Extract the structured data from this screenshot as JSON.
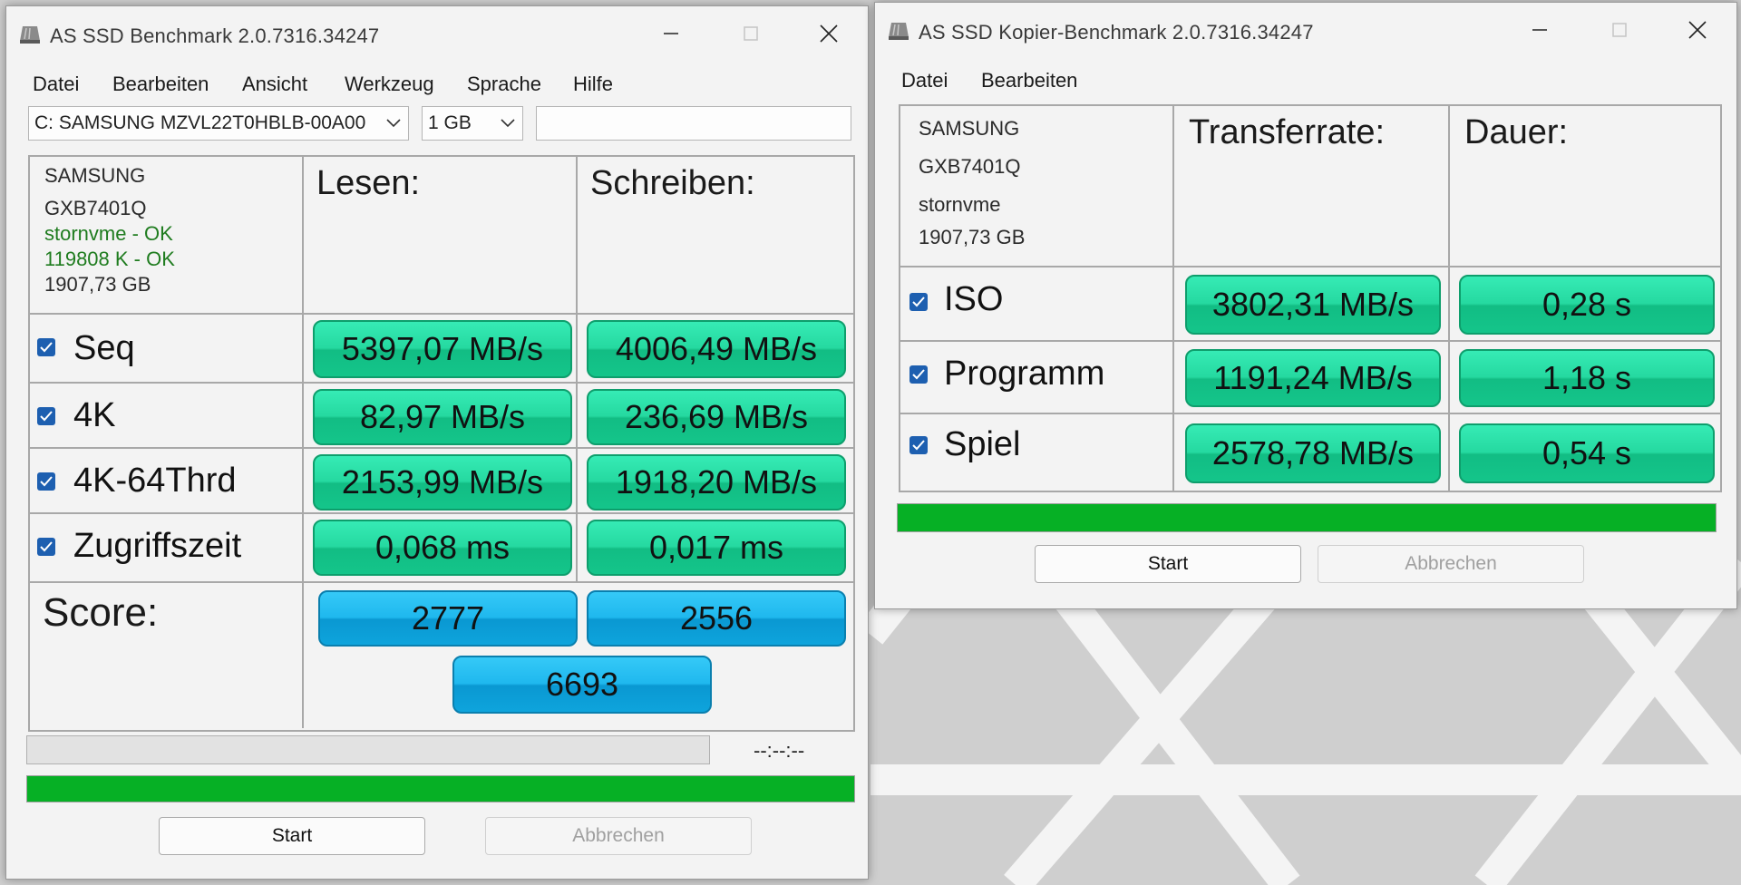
{
  "colors": {
    "value_green": "#25d9a0",
    "score_blue": "#1fb8ee",
    "progress_green": "#06b025",
    "ok_green": "#1f7c1f"
  },
  "main": {
    "title": "AS SSD Benchmark 2.0.7316.34247",
    "menu": [
      "Datei",
      "Bearbeiten",
      "Ansicht",
      "Werkzeug",
      "Sprache",
      "Hilfe"
    ],
    "drive_select": "C: SAMSUNG MZVL22T0HBLB-00A00",
    "size_select": "1 GB",
    "text_field": "",
    "info": {
      "vendor": "SAMSUNG",
      "firmware": "GXB7401Q",
      "driver": "stornvme - OK",
      "alignment": "119808 K - OK",
      "capacity": "1907,73 GB"
    },
    "col_read": "Lesen:",
    "col_write": "Schreiben:",
    "rows": [
      {
        "label": "Seq",
        "read": "5397,07 MB/s",
        "write": "4006,49 MB/s",
        "checked": true
      },
      {
        "label": "4K",
        "read": "82,97 MB/s",
        "write": "236,69 MB/s",
        "checked": true
      },
      {
        "label": "4K-64Thrd",
        "read": "2153,99 MB/s",
        "write": "1918,20 MB/s",
        "checked": true
      },
      {
        "label": "Zugriffszeit",
        "read": "0,068 ms",
        "write": "0,017 ms",
        "checked": true
      }
    ],
    "score_label": "Score:",
    "score_read": "2777",
    "score_write": "2556",
    "score_total": "6693",
    "time": "--:--:--",
    "progress_fraction": 1.0,
    "start": "Start",
    "cancel": "Abbrechen"
  },
  "copy": {
    "title": "AS SSD Kopier-Benchmark 2.0.7316.34247",
    "menu": [
      "Datei",
      "Bearbeiten"
    ],
    "info": {
      "vendor": "SAMSUNG",
      "firmware": "GXB7401Q",
      "driver": "stornvme",
      "capacity": "1907,73 GB"
    },
    "col_rate": "Transferrate:",
    "col_time": "Dauer:",
    "rows": [
      {
        "label": "ISO",
        "rate": "3802,31 MB/s",
        "time": "0,28 s",
        "checked": true
      },
      {
        "label": "Programm",
        "rate": "1191,24 MB/s",
        "time": "1,18 s",
        "checked": true
      },
      {
        "label": "Spiel",
        "rate": "2578,78 MB/s",
        "time": "0,54 s",
        "checked": true
      }
    ],
    "progress_fraction": 1.0,
    "start": "Start",
    "cancel": "Abbrechen"
  }
}
